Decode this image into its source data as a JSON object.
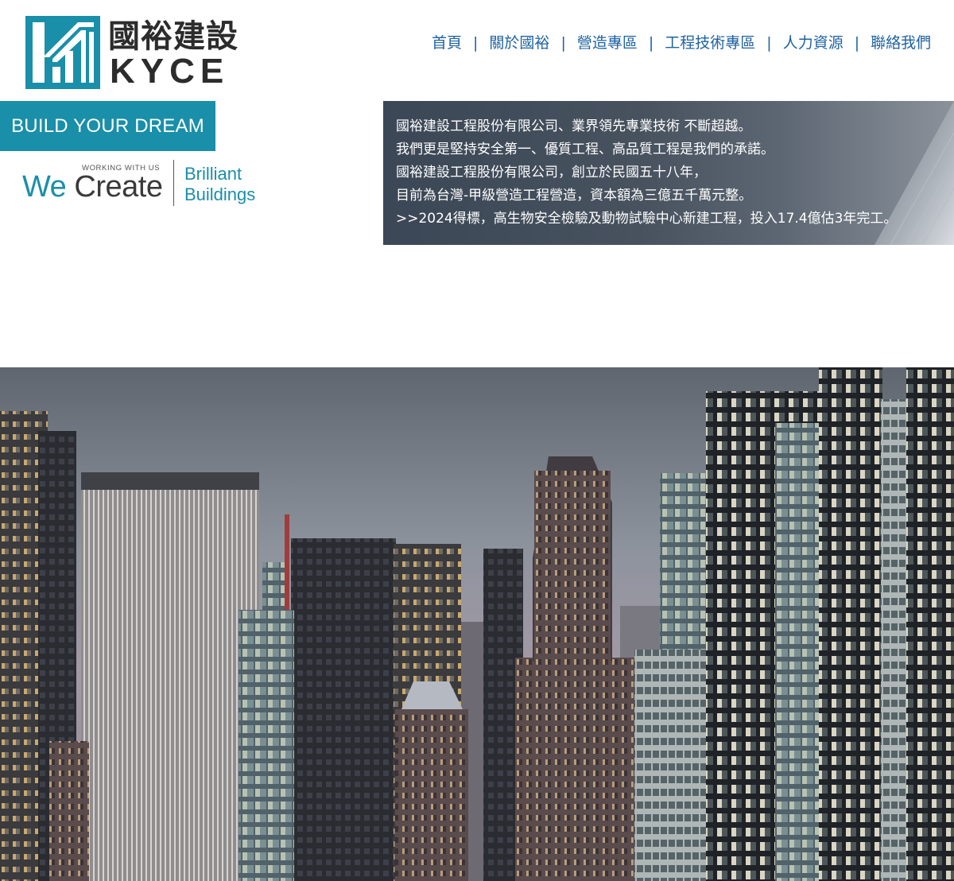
{
  "logo": {
    "chinese_name": "國裕建設",
    "english_name": "KYCE",
    "mark_icon": "kyce-logo-mark",
    "brand_color": "#1a8fa9"
  },
  "nav": {
    "items": [
      {
        "label": "首頁"
      },
      {
        "label": "關於國裕"
      },
      {
        "label": "營造專區"
      },
      {
        "label": "工程技術專區"
      },
      {
        "label": "人力資源"
      },
      {
        "label": "聯絡我們"
      }
    ],
    "separator": "|",
    "color": "#1f63a1"
  },
  "banner": {
    "build_your_dream": "BUILD YOUR DREAM",
    "working_with_us": "WORKING WITH US",
    "we": "We",
    "create": "Create",
    "brilliant": "Brilliant",
    "buildings": "Buildings"
  },
  "intro": {
    "lines": [
      "國裕建設工程股份有限公司、業界領先專業技術  不斷超越。",
      "我們更是堅持安全第一、優質工程、高品質工程是我們的承諾。",
      "國裕建設工程股份有限公司，創立於民國五十八年，",
      "目前為台灣-甲級營造工程營造，資本額為三億五千萬元整。",
      ">>2024得標，高生物安全檢驗及動物試驗中心新建工程，投入17.4億估3年完工。"
    ]
  },
  "hero": {
    "image_description": "city-skyline-photo"
  }
}
